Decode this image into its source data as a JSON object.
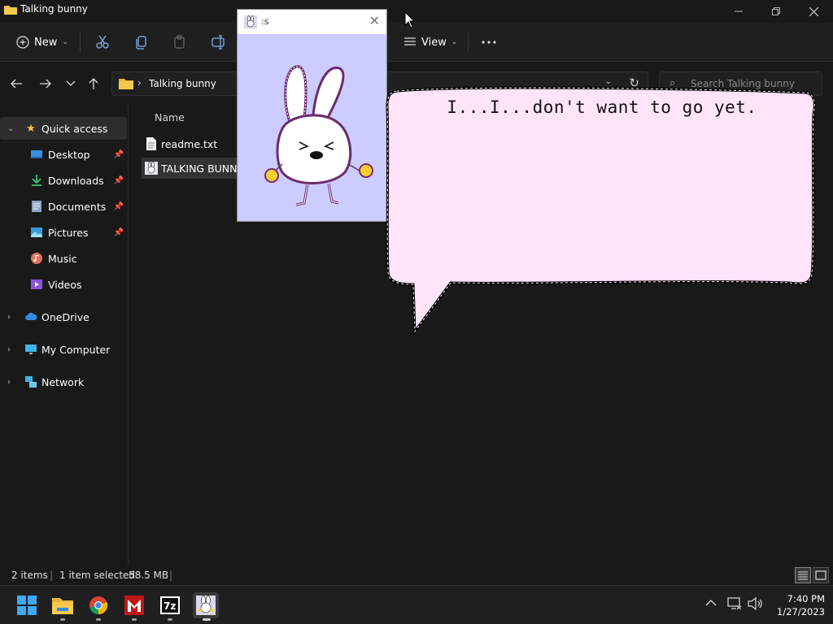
{
  "window": {
    "title": "Talking bunny",
    "controls": [
      "minimize-icon",
      "maximize-icon",
      "close-icon"
    ]
  },
  "commandbar": {
    "new_label": "New",
    "view_label": "View",
    "icons": [
      "cut-icon",
      "copy-icon",
      "paste-icon",
      "rename-icon",
      "view-icon",
      "more-icon"
    ]
  },
  "address": {
    "crumb": "Talking bunny",
    "search_placeholder": "Search Talking bunny"
  },
  "nav": {
    "quick_access": "Quick access",
    "items": [
      {
        "label": "Desktop",
        "pinned": true
      },
      {
        "label": "Downloads",
        "pinned": true
      },
      {
        "label": "Documents",
        "pinned": true
      },
      {
        "label": "Pictures",
        "pinned": true
      },
      {
        "label": "Music",
        "pinned": false
      },
      {
        "label": "Videos",
        "pinned": false
      }
    ],
    "roots": [
      {
        "label": "OneDrive"
      },
      {
        "label": "My Computer"
      },
      {
        "label": "Network"
      }
    ]
  },
  "content": {
    "column_name": "Name",
    "files": [
      {
        "name": "readme.txt",
        "selected": false
      },
      {
        "name": "TALKING BUNNY.",
        "selected": true
      }
    ]
  },
  "status": {
    "items": "2 items",
    "selected": "1 item selected",
    "size": "58.5 MB"
  },
  "bunny_window": {
    "title": ":s",
    "background": "#ccccff"
  },
  "speech": {
    "text": "I...I...don't want to go yet.",
    "fill": "#ffe4fa"
  },
  "taskbar": {
    "apps": [
      "windows-start-icon",
      "file-explorer-icon",
      "chrome-icon",
      "mcafee-icon",
      "7zip-icon",
      "talking-bunny-icon"
    ],
    "clock_time": "7:40 PM",
    "clock_date": "1/27/2023"
  }
}
